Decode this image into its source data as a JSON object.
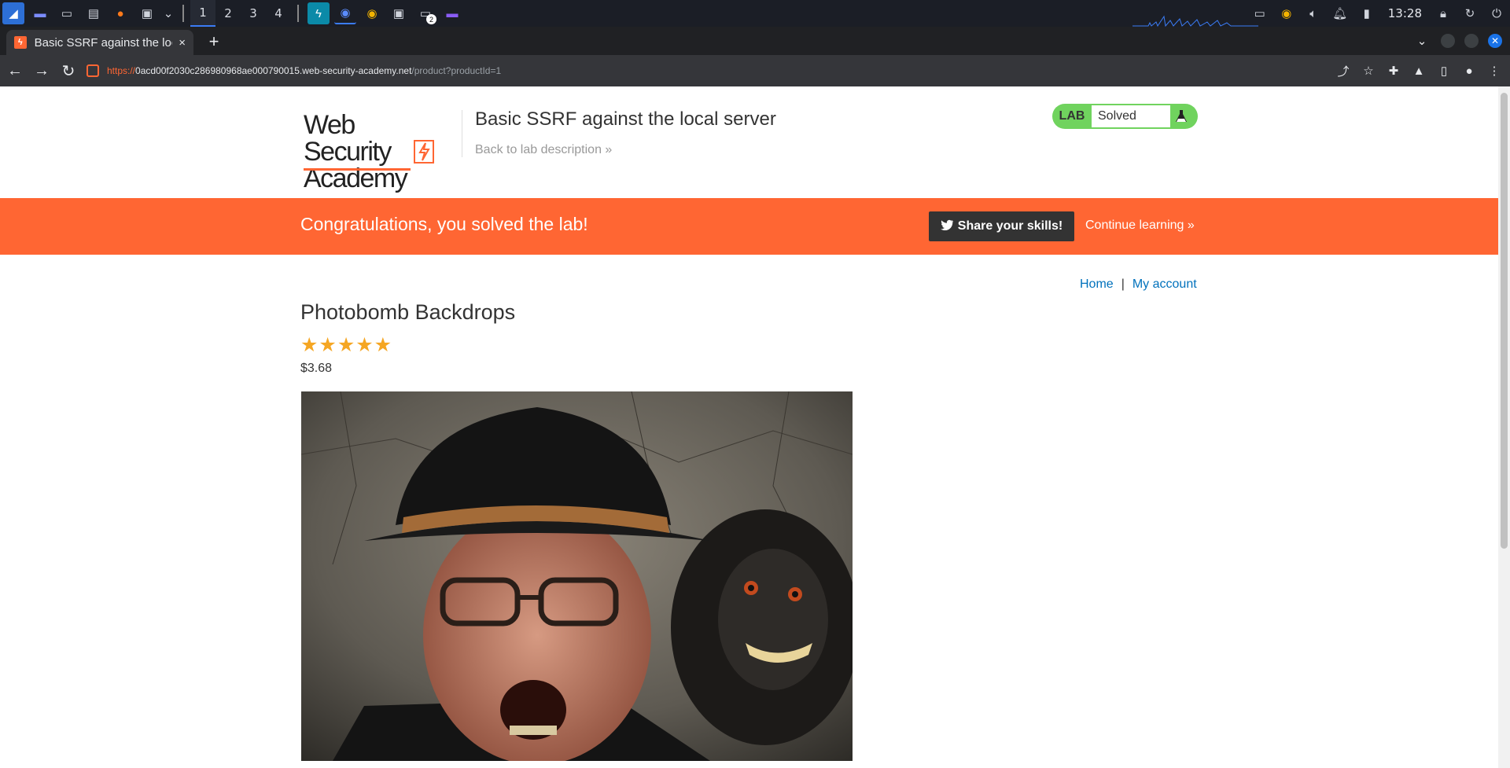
{
  "taskbar": {
    "workspaces": [
      "1",
      "2",
      "3",
      "4"
    ],
    "notification_count": "2",
    "clock": "13:28"
  },
  "browser": {
    "tab_title": "Basic SSRF against the local server",
    "tab_close": "×",
    "new_tab": "+",
    "url_scheme": "https://",
    "url_host": "0acd00f2030c286980968ae000790015.web-security-academy.net",
    "url_path": "/product?productId=1"
  },
  "header": {
    "logo_line1": "Web Security",
    "logo_line2": "Academy",
    "lab_title": "Basic SSRF against the local server",
    "back_link": "Back to lab description »",
    "lab_tag": "LAB",
    "lab_state": "Solved"
  },
  "banner": {
    "message": "Congratulations, you solved the lab!",
    "share_label": "Share your skills!",
    "continue_label": "Continue learning »"
  },
  "nav": {
    "home": "Home",
    "separator": "|",
    "account": "My account"
  },
  "product": {
    "title": "Photobomb Backdrops",
    "rating_stars": 5,
    "stars_text": "★★★★★",
    "price": "$3.68"
  },
  "colors": {
    "brand_orange": "#ff6633",
    "lab_green": "#70d35e",
    "link_blue": "#0071bc",
    "star_gold": "#f5a623"
  }
}
